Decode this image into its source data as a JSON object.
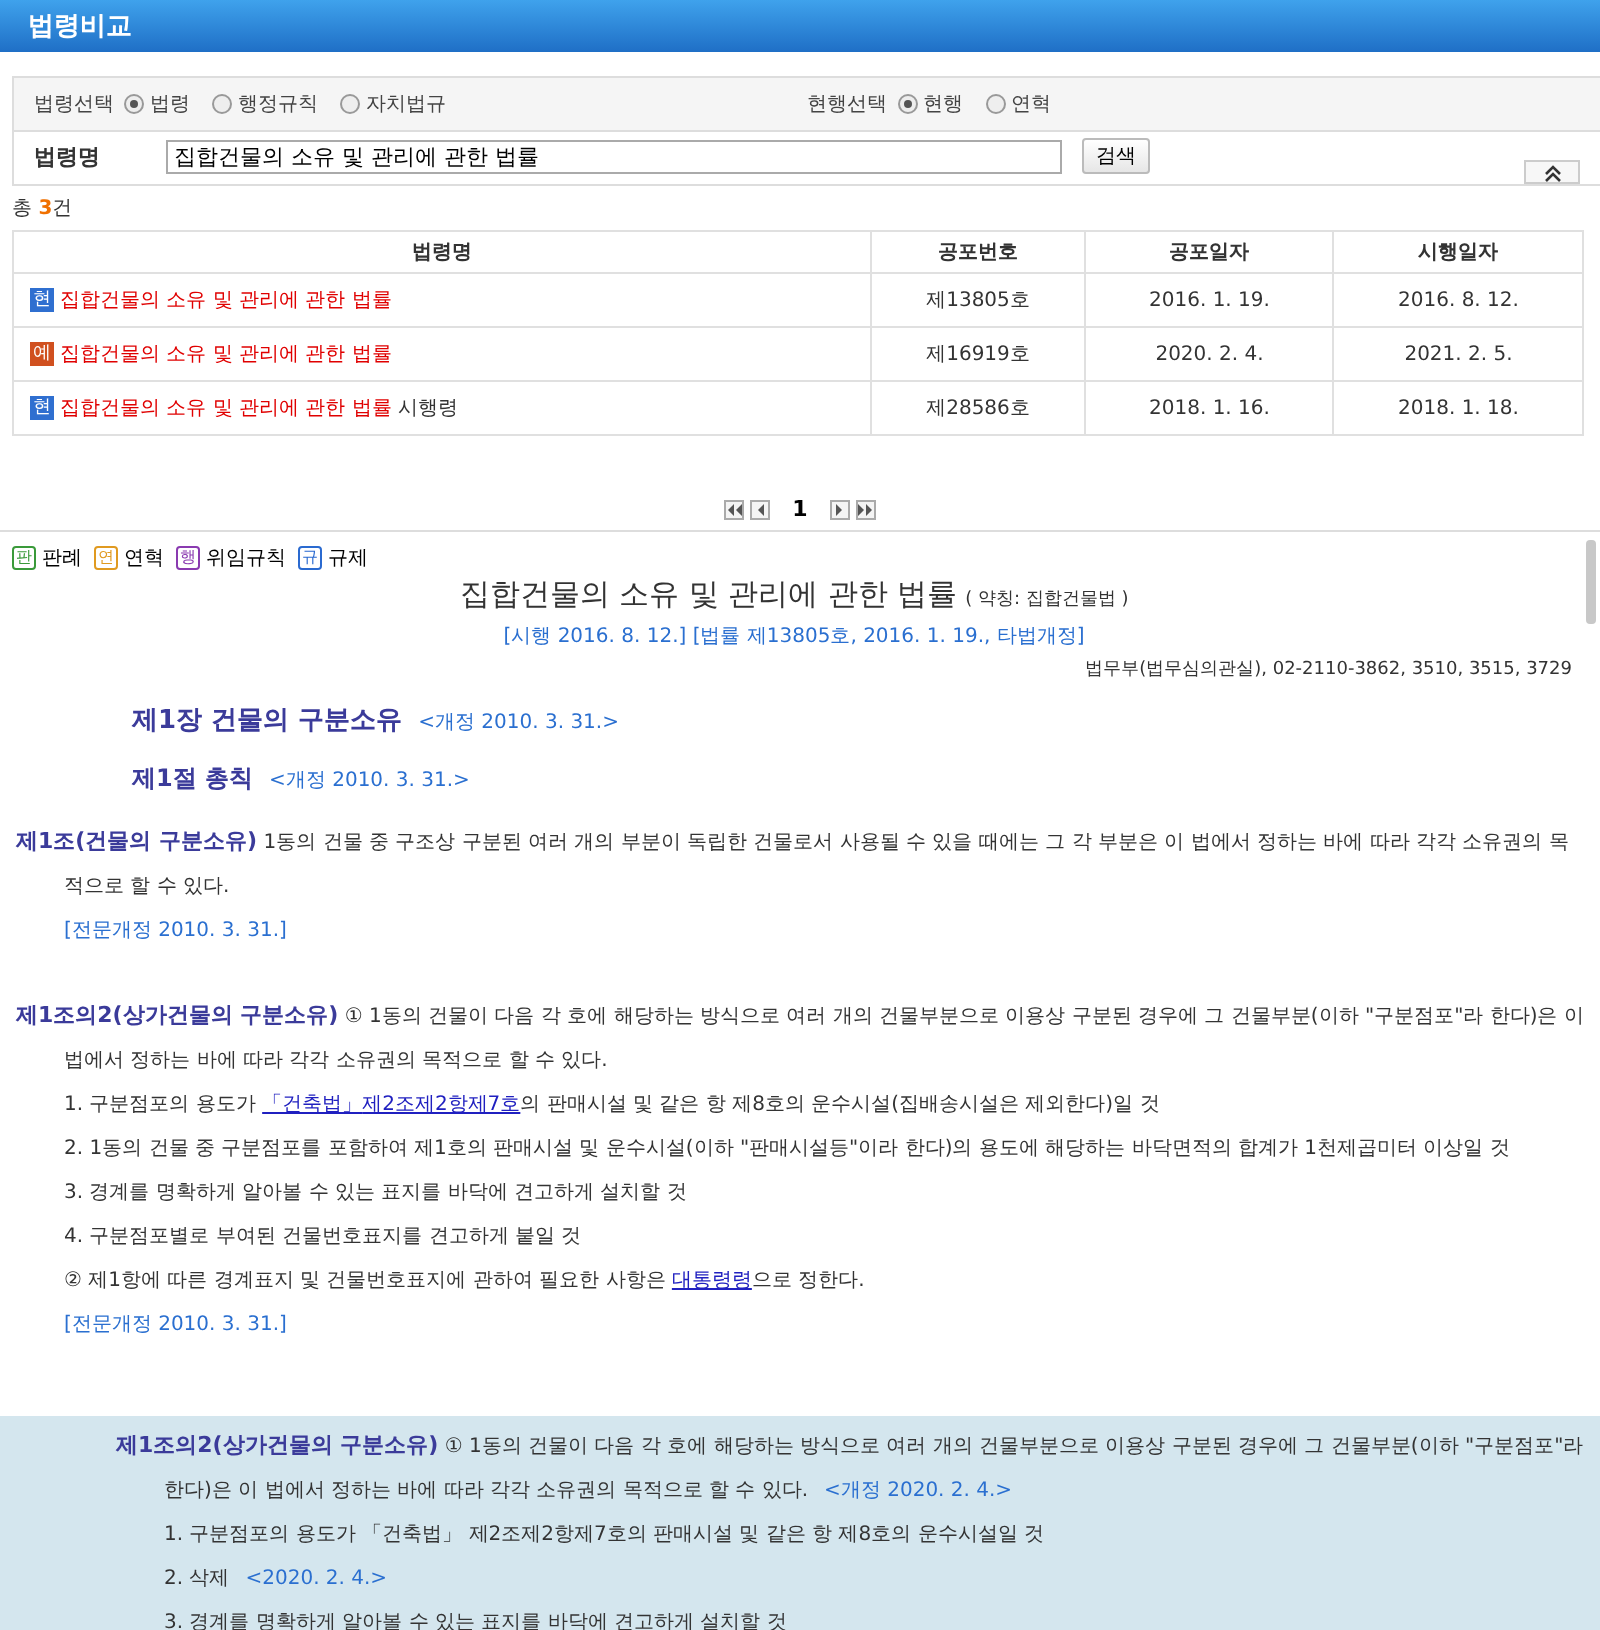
{
  "header": {
    "title": "법령비교"
  },
  "filters": [
    {
      "label": "법령선택",
      "options": [
        {
          "label": "법령",
          "selected": true
        },
        {
          "label": "행정규칙",
          "selected": false
        },
        {
          "label": "자치법규",
          "selected": false
        }
      ]
    },
    {
      "label": "현행선택",
      "options": [
        {
          "label": "현행",
          "selected": true
        },
        {
          "label": "연혁",
          "selected": false
        }
      ]
    }
  ],
  "search": {
    "label": "법령명",
    "value": "집합건물의 소유 및 관리에 관한 법률",
    "button": "검색"
  },
  "result_count": {
    "prefix": "총 ",
    "count": "3",
    "suffix": "건"
  },
  "table": {
    "columns": [
      "법령명",
      "공포번호",
      "공포일자",
      "시행일자"
    ],
    "rows": [
      {
        "badge": "현",
        "kind": "current",
        "title": "집합건물의 소유 및 관리에 관한 법률",
        "suffix": "",
        "number": "제13805호",
        "promulgated": "2016. 1. 19.",
        "effective": "2016. 8. 12."
      },
      {
        "badge": "예",
        "kind": "scheduled",
        "title": "집합건물의 소유 및 관리에 관한 법률",
        "suffix": "",
        "number": "제16919호",
        "promulgated": "2020. 2. 4.",
        "effective": "2021. 2. 5."
      },
      {
        "badge": "현",
        "kind": "current",
        "title": "집합건물의 소유 및 관리에 관한 법률",
        "suffix": "시행령",
        "number": "제28586호",
        "promulgated": "2018. 1. 16.",
        "effective": "2018. 1. 18."
      }
    ]
  },
  "pagination": {
    "page": "1"
  },
  "legend": [
    {
      "mark": "판",
      "label": "판례",
      "color": "#3a9a3a"
    },
    {
      "mark": "연",
      "label": "연혁",
      "color": "#e09a20"
    },
    {
      "mark": "행",
      "label": "위임규칙",
      "color": "#8a3ab0"
    },
    {
      "mark": "규",
      "label": "규제",
      "color": "#2a6ad0"
    }
  ],
  "document": {
    "title": "집합건물의 소유 및 관리에 관한 법률",
    "abbrev": "( 약칭: 집합건물법 )",
    "history": "[시행 2016. 8. 12.] [법률 제13805호, 2016. 1. 19., 타법개정]",
    "ministry": "법무부(법무심의관실), 02-2110-3862, 3510, 3515, 3729",
    "headings": [
      {
        "kind": "chapter",
        "text": "제1장 건물의 구분소유",
        "amendment": "<개정 2010. 3. 31.>"
      },
      {
        "kind": "section",
        "text": "제1절 총칙",
        "amendment": "<개정 2010. 3. 31.>"
      }
    ],
    "articles": [
      {
        "highlighted": false,
        "heading": "제1조(건물의 구분소유)",
        "text": "1동의 건물 중 구조상 구분된 여러 개의 부분이 독립한 건물로서 사용될 수 있을 때에는 그 각 부분은 이 법에서 정하는 바에 따라 각각 소유권의 목적으로 할 수 있다.",
        "note": "[전문개정 2010. 3. 31.]"
      },
      {
        "highlighted": false,
        "heading": "제1조의2(상가건물의 구분소유)",
        "text": "① 1동의 건물이 다음 각 호에 해당하는 방식으로 여러 개의 건물부분으로 이용상 구분된 경우에 그 건물부분(이하 \"구분점포\"라 한다)은 이 법에서 정하는 바에 따라 각각 소유권의 목적으로 할 수 있다.",
        "items": [
          {
            "parts": [
              {
                "text": "1. 구분점포의 용도가 "
              },
              {
                "text": "「건축법」",
                "link": true
              },
              {
                "text": "제2조제2항제7호",
                "link": true
              },
              {
                "text": "의 판매시설 및 같은 항 제8호의 운수시설(집배송시설은 제외한다)일 것"
              }
            ]
          },
          {
            "parts": [
              {
                "text": "2. 1동의 건물 중 구분점포를 포함하여 제1호의 판매시설 및 운수시설(이하 \"판매시설등\"이라 한다)의 용도에 해당하는 바닥면적의 합계가 1천제곱미터 이상일 것"
              }
            ]
          },
          {
            "parts": [
              {
                "text": "3. 경계를 명확하게 알아볼 수 있는 표지를 바닥에 견고하게 설치할 것"
              }
            ]
          },
          {
            "parts": [
              {
                "text": "4. 구분점포별로 부여된 건물번호표지를 견고하게 붙일 것"
              }
            ]
          },
          {
            "parts": [
              {
                "text": "② 제1항에 따른 경계표지 및 건물번호표지에 관하여 필요한 사항은 "
              },
              {
                "text": "대통령령",
                "link": true
              },
              {
                "text": "으로 정한다."
              }
            ]
          }
        ],
        "note": "[전문개정 2010. 3. 31.]"
      },
      {
        "highlighted": true,
        "heading": "제1조의2(상가건물의 구분소유)",
        "text": "① 1동의 건물이 다음 각 호에 해당하는 방식으로 여러 개의 건물부분으로 이용상 구분된 경우에 그 건물부분(이하 \"구분점포\"라 한다)은 이 법에서 정하는 바에 따라 각각 소유권의 목적으로 할 수 있다.",
        "amendment": "<개정 2020. 2. 4.>",
        "items": [
          {
            "parts": [
              {
                "text": "1. 구분점포의 용도가 「건축법」 제2조제2항제7호의 판매시설 및 같은 항 제8호의 운수시설일 것"
              }
            ]
          },
          {
            "parts": [
              {
                "text": "2. 삭제"
              }
            ],
            "amendment": "<2020. 2. 4.>"
          },
          {
            "parts": [
              {
                "text": "3. 경계를 명확하게 알아볼 수 있는 표지를 바닥에 견고하게 설치할 것"
              }
            ]
          }
        ]
      }
    ]
  }
}
